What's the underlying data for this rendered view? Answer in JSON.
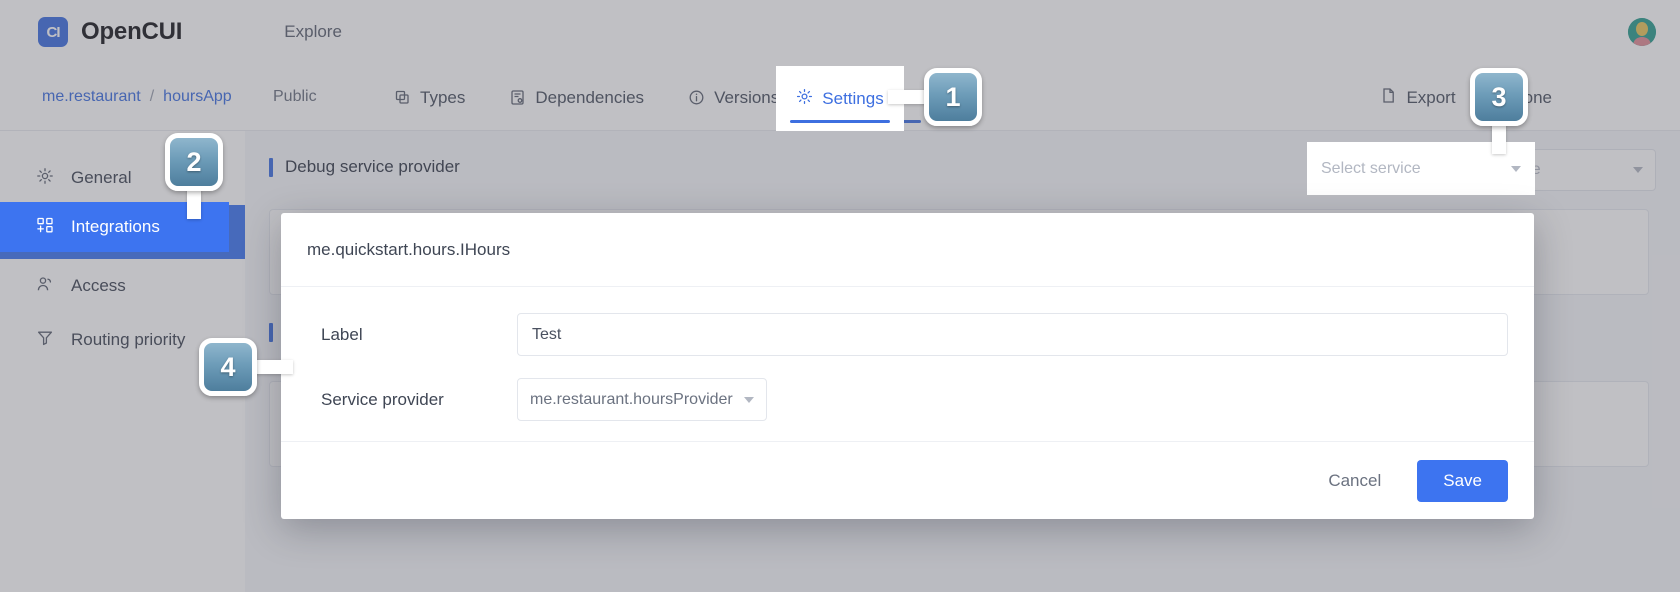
{
  "header": {
    "brand_mark": "CI",
    "brand_name": "OpenCUI",
    "explore_label": "Explore",
    "avatar_name": "user-avatar"
  },
  "breadcrumb": {
    "org": "me.restaurant",
    "separator": "/",
    "app": "hoursApp",
    "visibility": "Public"
  },
  "tabs": [
    {
      "label": "Types",
      "icon": "types-icon",
      "active": false
    },
    {
      "label": "Dependencies",
      "icon": "dependencies-icon",
      "active": false
    },
    {
      "label": "Versions",
      "icon": "versions-icon",
      "active": false
    },
    {
      "label": "Settings",
      "icon": "gear-icon",
      "active": true
    }
  ],
  "toolbar": {
    "export_label": "Export",
    "clone_label": "Clone"
  },
  "sidebar": {
    "items": [
      {
        "label": "General",
        "icon": "gear-icon",
        "active": false
      },
      {
        "label": "Integrations",
        "icon": "grid-plus-icon",
        "active": true
      },
      {
        "label": "Access",
        "icon": "people-icon",
        "active": false
      },
      {
        "label": "Routing priority",
        "icon": "funnel-icon",
        "active": false
      }
    ]
  },
  "content": {
    "section_title": "Debug service provider",
    "select_service_placeholder": "Select service"
  },
  "modal": {
    "title": "me.quickstart.hours.IHours",
    "fields": [
      {
        "label": "Label",
        "value": "Test",
        "type": "text"
      },
      {
        "label": "Service provider",
        "value": "me.restaurant.hoursProvider",
        "type": "select"
      }
    ],
    "cancel_label": "Cancel",
    "save_label": "Save"
  },
  "callouts": [
    {
      "number": "1"
    },
    {
      "number": "2"
    },
    {
      "number": "3"
    },
    {
      "number": "4"
    }
  ],
  "colors": {
    "accent_blue": "#3d6fe0",
    "active_blue": "#3d74f0",
    "badge_blue": "#6d9cb8",
    "text_dark": "#3f4654",
    "muted": "#9aa0ae"
  }
}
